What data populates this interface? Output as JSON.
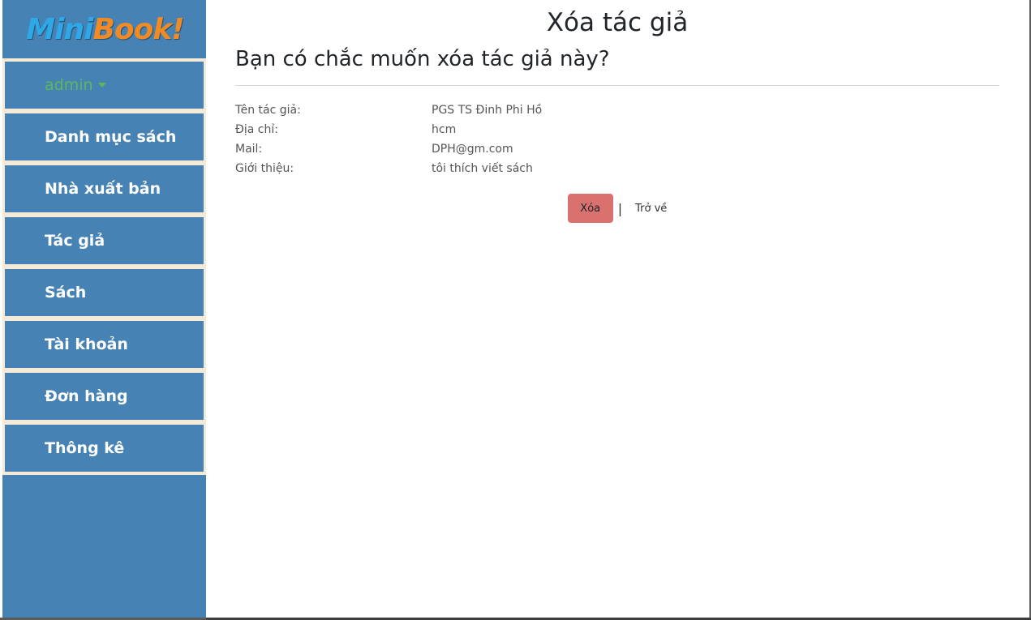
{
  "logo": {
    "mini": "Mini",
    "book": "Book!"
  },
  "sidebar": {
    "user": "admin",
    "items": [
      {
        "label": "Danh mục sách"
      },
      {
        "label": "Nhà xuất bản"
      },
      {
        "label": "Tác giả"
      },
      {
        "label": "Sách"
      },
      {
        "label": "Tài khoản"
      },
      {
        "label": "Đơn hàng"
      },
      {
        "label": "Thông kê"
      }
    ]
  },
  "main": {
    "title": "Xóa tác giả",
    "confirm": "Bạn có chắc muốn xóa tác giả này?",
    "details": [
      {
        "label": "Tên tác giả:",
        "value": "PGS TS Đinh Phi Hồ"
      },
      {
        "label": "Địa chỉ:",
        "value": "hcm"
      },
      {
        "label": "Mail:",
        "value": "DPH@gm.com"
      },
      {
        "label": "Giới thiệu:",
        "value": "tôi thích viết sách"
      }
    ],
    "delete_label": "Xóa",
    "separator": "|",
    "back_label": "Trở về"
  },
  "colors": {
    "sidebar_bg": "#4682b4",
    "menu_border": "#f5ead6",
    "admin_text": "#5cb85c",
    "delete_button": "#d9716e"
  }
}
